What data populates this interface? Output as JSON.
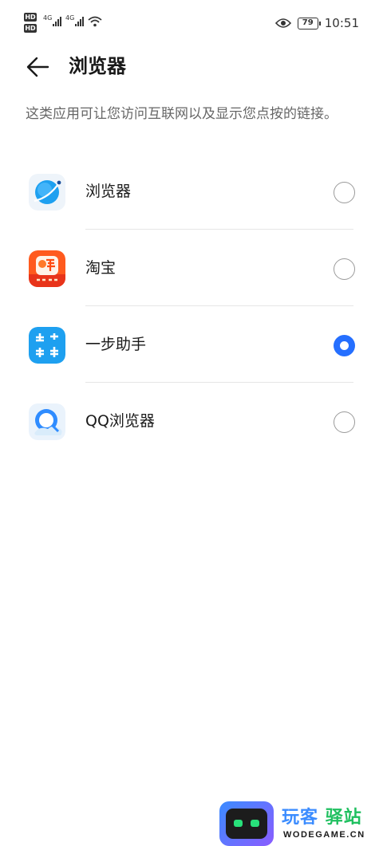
{
  "status_bar": {
    "hd_label": "HD",
    "network_label": "4G",
    "battery_level": "79",
    "time": "10:51"
  },
  "header": {
    "title": "浏览器"
  },
  "description": "这类应用可让您访问互联网以及显示您点按的链接。",
  "apps": [
    {
      "name": "浏览器",
      "icon": "huawei-browser-icon",
      "selected": false
    },
    {
      "name": "淘宝",
      "icon": "taobao-icon",
      "selected": false
    },
    {
      "name": "一步助手",
      "icon": "yibu-assistant-icon",
      "selected": true
    },
    {
      "name": "QQ浏览器",
      "icon": "qq-browser-icon",
      "selected": false
    }
  ],
  "watermark": {
    "title_a": "玩客",
    "title_b": "驿站",
    "domain": "WODEGAME.CN"
  },
  "colors": {
    "accent": "#256fff",
    "text_primary": "#1a1a1a",
    "text_secondary": "#666666",
    "divider": "#e6e6e6"
  }
}
